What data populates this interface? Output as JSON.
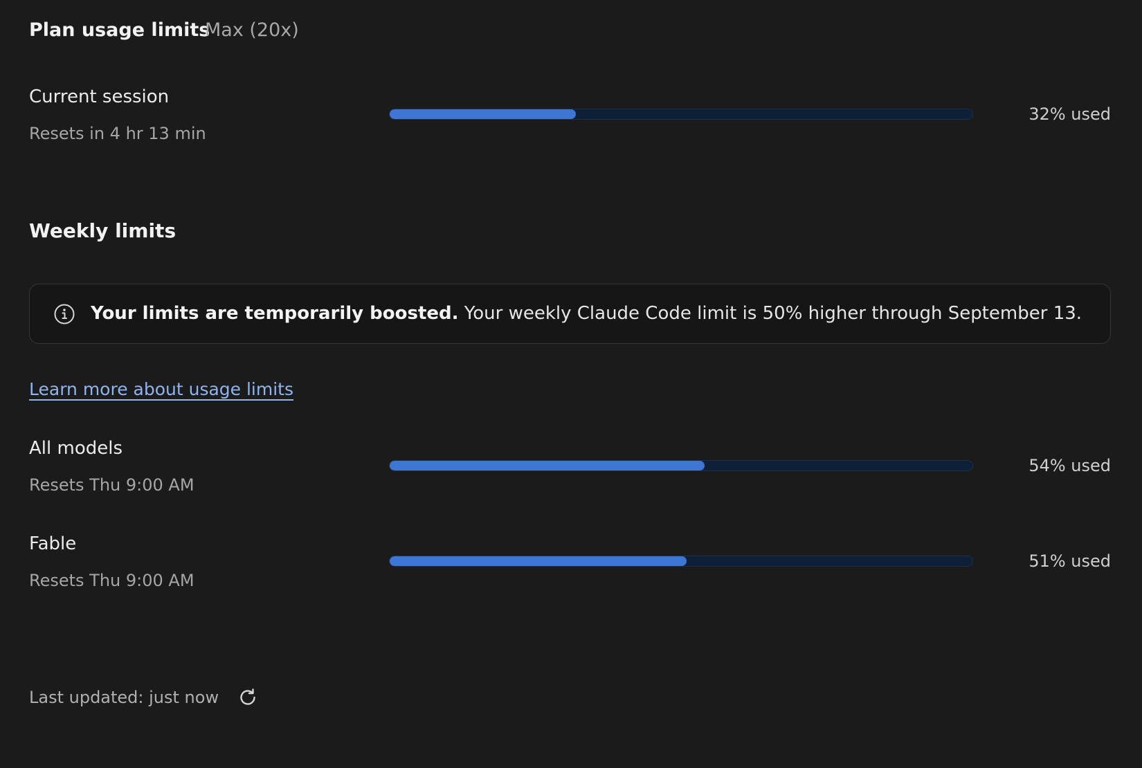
{
  "header": {
    "title": "Plan usage limits",
    "plan_badge": "Max (20x)"
  },
  "current_session": {
    "label": "Current session",
    "reset_text": "Resets in 4 hr 13 min",
    "percent_used": 32,
    "percent_label": "32% used"
  },
  "weekly": {
    "title": "Weekly limits",
    "notice": {
      "icon": "info-icon",
      "bold_text": "Your limits are temporarily boosted.",
      "text": " Your weekly Claude Code limit is 50% higher through September 13."
    },
    "learn_more_link": "Learn more about usage limits",
    "rows": [
      {
        "label": "All models",
        "reset_text": "Resets Thu 9:00 AM",
        "percent_used": 54,
        "percent_label": "54% used"
      },
      {
        "label": "Fable",
        "reset_text": "Resets Thu 9:00 AM",
        "percent_used": 51,
        "percent_label": "51% used"
      }
    ]
  },
  "footer": {
    "last_updated": "Last updated: just now",
    "refresh_icon": "refresh-icon"
  },
  "colors": {
    "background": "#1b1b1b",
    "bar_fill": "#3e76d6",
    "bar_track": "#0e2038",
    "link": "#8fb4f0"
  }
}
